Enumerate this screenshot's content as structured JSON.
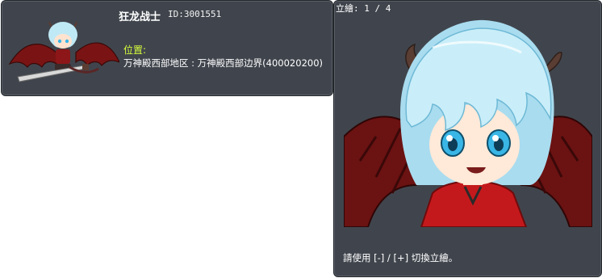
{
  "npc": {
    "name": "狂龙战士",
    "id_label": "ID:",
    "id_value": "3001551",
    "location_label": "位置:",
    "location_value": "万神殿西部地区 : 万神殿西部边界(400020200)"
  },
  "standee": {
    "label": "立繪:",
    "current": "1",
    "separator": "/",
    "total": "4",
    "hint": "請使用 [-] / [+] 切換立繪。"
  },
  "colors": {
    "panel_bg": "#40454d",
    "location_label": "#d7ff3a",
    "hair": "#bfe9f5",
    "wings": "#7a1414",
    "horns": "#5a3d33",
    "eyes": "#39b6e6",
    "shirt": "#c4191c"
  },
  "icons": {
    "sprite": "demon-slayer-sprite",
    "portrait": "demon-slayer-portrait"
  }
}
